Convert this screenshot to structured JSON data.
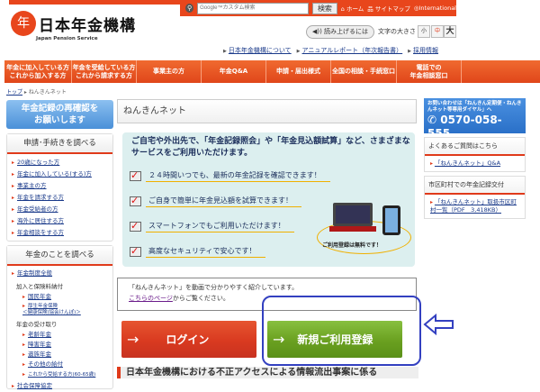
{
  "header": {
    "logo_mark": "年",
    "logo_text": "日本年金機構",
    "logo_sub": "Japan Pension Service",
    "search_placeholder": "Google™カスタム検索",
    "search_button": "検索",
    "top_links": [
      "⌂ ホーム",
      "品 サイトマップ",
      "◎International"
    ],
    "read_aloud": "◀)) 読み上げるには",
    "font_size_label": "文字の大きさ",
    "font_sizes": [
      "小",
      "中",
      "大"
    ],
    "sub_links": [
      "日本年金機構について",
      "アニュアルレポート（年次報告書）",
      "採用情報"
    ]
  },
  "nav": [
    "年金に加入している方\nこれから加入する方",
    "年金を受給している方\nこれから請求する方",
    "事業主の方",
    "年金Q&A",
    "申請・届出様式",
    "全国の相談・手続窓口",
    "電話での\n年金相談窓口"
  ],
  "breadcrumb": {
    "home": "トップ",
    "current": "ねんきんネット"
  },
  "sidebar": {
    "banner": "年金記録の再確認を\nお願いします",
    "section1": {
      "title": "申請･手続きを調べる",
      "items": [
        "20歳になった方",
        "年金に加入している(する)方",
        "事業主の方",
        "年金を請求する方",
        "年金受給者の方",
        "海外に居住する方",
        "年金相談をする方"
      ]
    },
    "section2": {
      "title": "年金のことを調べる",
      "item_top": "年金制度全般",
      "group1": "加入と保険料納付",
      "group1_items": [
        "国民年金",
        "厚生年金保険\n＜健康保険(協会けんぽ)＞"
      ],
      "group2": "年金の受け取り",
      "group2_items": [
        "老齢年金",
        "障害年金",
        "遺族年金",
        "その他の給付",
        "これから受給する方(60-65歳)"
      ],
      "item_bottom": "社会保障協定"
    }
  },
  "main": {
    "title": "ねんきんネット",
    "headline": "ご自宅や外出先で、「年金記録照会」や「年金見込額試算」など、さまざまなサービスをご利用いただけます。",
    "features": [
      "２４時間いつでも、最新の年金記録を確認できます！",
      "ご自身で簡単に年金見込額を試算できます！",
      "スマートフォンでもご利用いただけます！",
      "高度なセキュリティで安心です！"
    ],
    "device_caption": "ご利用登録は無料です！",
    "video_text": "「ねんきんネット」を動画で分かりやすく紹介しています。",
    "video_link": "こちらのページ",
    "video_suffix": "からご覧ください。",
    "login_button": "ログイン",
    "register_button": "新規ご利用登録",
    "bottom_heading": "日本年金機構における不正アクセスによる情報流出事案に係る"
  },
  "right": {
    "contact_text": "お問い合わせは「ねんきん定期便・ねんきんネット等専用ダイヤル」へ",
    "contact_number": "0570-058-555",
    "faq_title": "よくあるご質問はこちら",
    "faq_link": "「ねんきんネット」Q&A",
    "muni_title": "市区町村での年金記録交付",
    "muni_link": "「ねんきんネット」取扱市区町村一覧（PDF　3,418KB）"
  },
  "colors": {
    "brand": "#e8461c",
    "login": "#d93a20",
    "register": "#6aa020",
    "highlight": "#3340c0"
  }
}
